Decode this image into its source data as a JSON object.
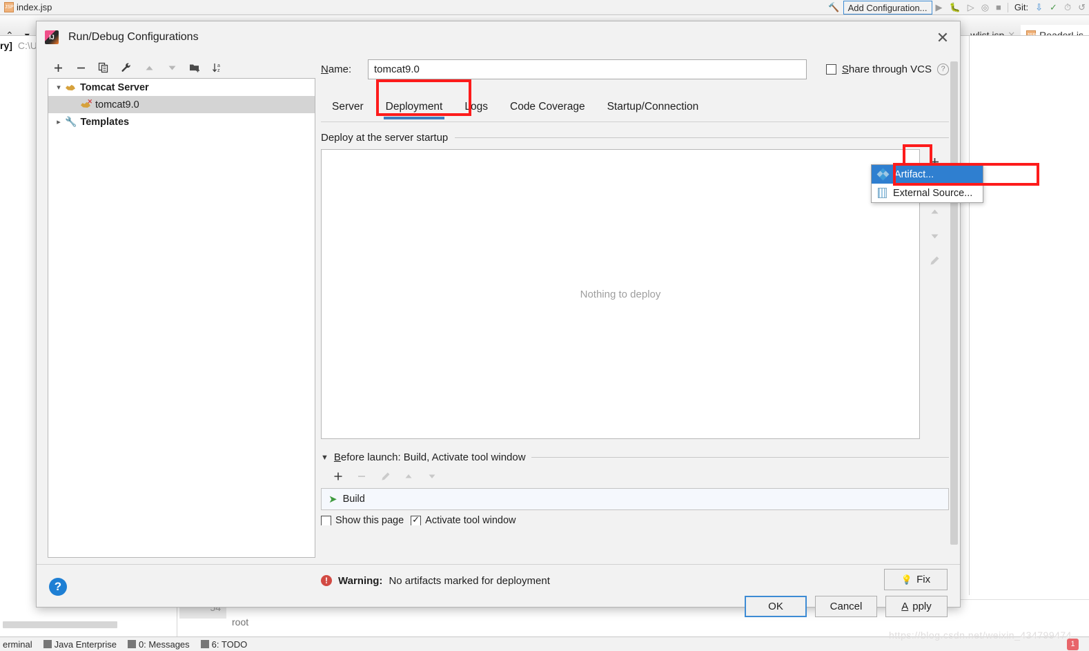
{
  "background": {
    "editor_tab_left": "index.jsp",
    "breadcrumb_bold": "ry]",
    "breadcrumb_path": "C:\\U",
    "toolbar": {
      "add_configuration": "Add Configuration...",
      "git_label": "Git:",
      "icons": [
        "hammer-icon",
        "run-icon",
        "debug-icon",
        "run-coverage-icon",
        "profile-icon",
        "stop-icon",
        "update-project-icon",
        "commit-icon",
        "history-icon",
        "rollback-icon"
      ]
    },
    "editor_tabs_right": [
      {
        "label": "wlist.jsp",
        "active": false
      },
      {
        "label": "ReaderLis",
        "active": true
      }
    ],
    "gutter_line_number": "54",
    "code_text": "root",
    "statusbar": [
      {
        "label": "erminal",
        "icon": "terminal-icon"
      },
      {
        "label": "Java Enterprise",
        "icon": "java-enterprise-icon"
      },
      {
        "label": "0: Messages",
        "icon": "messages-icon"
      },
      {
        "label": "6: TODO",
        "icon": "todo-icon"
      }
    ],
    "watermark": "https://blog.csdn.net/weixin_434799474",
    "watermark_badge": "1"
  },
  "dialog": {
    "title": "Run/Debug Configurations",
    "close_label": "✕",
    "left_toolbar": [
      {
        "name": "add-configuration-button",
        "glyph": "+",
        "dim": false
      },
      {
        "name": "remove-configuration-button",
        "glyph": "−",
        "dim": false
      },
      {
        "name": "copy-configuration-button",
        "glyph": "❐",
        "dim": false
      },
      {
        "name": "edit-templates-button",
        "glyph": "🔧",
        "dim": false
      },
      {
        "name": "move-up-button",
        "glyph": "▲",
        "dim": true
      },
      {
        "name": "move-down-button",
        "glyph": "▼",
        "dim": true
      },
      {
        "name": "new-folder-button",
        "glyph": "➕",
        "dim": false
      },
      {
        "name": "sort-configurations-button",
        "glyph": "↓",
        "dim": false
      }
    ],
    "tree": [
      {
        "label": "Tomcat Server",
        "level": 0,
        "expanded": true,
        "icon": "tomcat-icon",
        "selected": false
      },
      {
        "label": "tomcat9.0",
        "level": 1,
        "expanded": null,
        "icon": "tomcat-error-icon",
        "selected": true
      },
      {
        "label": "Templates",
        "level": 0,
        "expanded": false,
        "icon": "wrench-icon",
        "selected": false
      }
    ],
    "name_label": "Name:",
    "name_label_mnemonic": "N",
    "name_value": "tomcat9.0",
    "name_placeholder": "Name",
    "share_vcs_label": "Share through VCS",
    "share_vcs_mnemonic": "S",
    "share_vcs_checked": false,
    "help_hint": "?",
    "tabs": [
      {
        "label": "Server",
        "active": false
      },
      {
        "label": "Deployment",
        "active": true
      },
      {
        "label": "Logs",
        "active": false
      },
      {
        "label": "Code Coverage",
        "active": false
      },
      {
        "label": "Startup/Connection",
        "active": false
      }
    ],
    "deploy_legend": "Deploy at the server startup",
    "deploy_empty_text": "Nothing to deploy",
    "deploy_side_buttons": [
      {
        "name": "add-deployment-button",
        "glyph": "+",
        "dim": false
      },
      {
        "name": "remove-deployment-button",
        "glyph": "−",
        "dim": true
      },
      {
        "name": "move-deployment-up-button",
        "glyph": "▲",
        "dim": true
      },
      {
        "name": "move-deployment-down-button",
        "glyph": "▼",
        "dim": true
      },
      {
        "name": "edit-deployment-button",
        "glyph": "✎",
        "dim": true
      }
    ],
    "popup_menu": {
      "items": [
        {
          "label": "Artifact...",
          "icon": "artifact-icon",
          "selected": true
        },
        {
          "label": "External Source...",
          "icon": "external-source-icon",
          "selected": false
        }
      ]
    },
    "before_launch": {
      "header": "Before launch: Build, Activate tool window",
      "header_mnemonic": "B",
      "toolbar": [
        {
          "name": "add-task-button",
          "glyph": "+",
          "dim": false
        },
        {
          "name": "remove-task-button",
          "glyph": "−",
          "dim": true
        },
        {
          "name": "edit-task-button",
          "glyph": "✎",
          "dim": true
        },
        {
          "name": "task-move-up-button",
          "glyph": "▲",
          "dim": true
        },
        {
          "name": "task-move-down-button",
          "glyph": "▼",
          "dim": true
        }
      ],
      "tasks": [
        {
          "label": "Build",
          "icon": "hammer-icon"
        }
      ],
      "show_page_label": "Show this page",
      "show_page_checked": false,
      "activate_tool_window_label": "Activate tool window",
      "activate_tool_window_checked": true
    },
    "warning_prefix": "Warning:",
    "warning_text": "No artifacts marked for deployment",
    "fix_label": "Fix",
    "buttons": {
      "ok": "OK",
      "cancel": "Cancel",
      "apply": "Apply",
      "apply_mnemonic": "A"
    },
    "help_button": "?"
  },
  "annotations": {
    "color": "#fd1b1b",
    "boxes": [
      {
        "name": "deployment-tab-highlight"
      },
      {
        "name": "add-button-highlight"
      },
      {
        "name": "artifact-menu-item-highlight"
      }
    ]
  }
}
